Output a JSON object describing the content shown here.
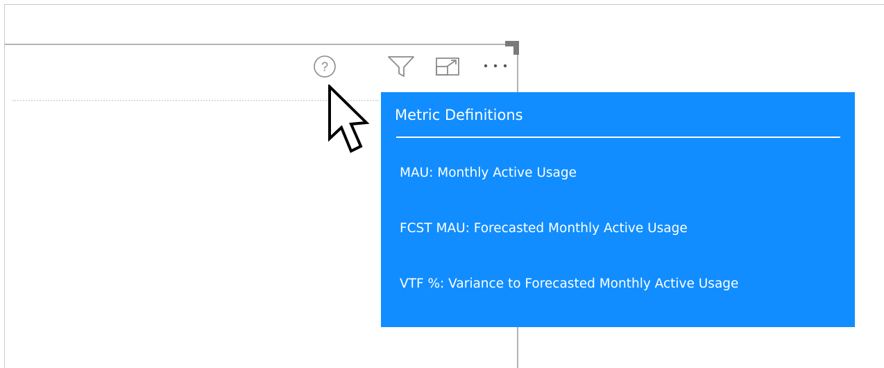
{
  "visual_header": {
    "icons": [
      {
        "name": "help-icon",
        "glyph": "?"
      },
      {
        "name": "filter-icon"
      },
      {
        "name": "focus-mode-icon"
      },
      {
        "name": "more-options-icon"
      }
    ]
  },
  "tooltip": {
    "title": "Metric Definitions",
    "items": [
      "MAU: Monthly Active Usage",
      "FCST MAU: Forecasted Monthly Active Usage",
      "VTF %: Variance to Forecasted Monthly Active Usage"
    ],
    "background_color": "#118dff",
    "text_color": "#ffffff"
  }
}
